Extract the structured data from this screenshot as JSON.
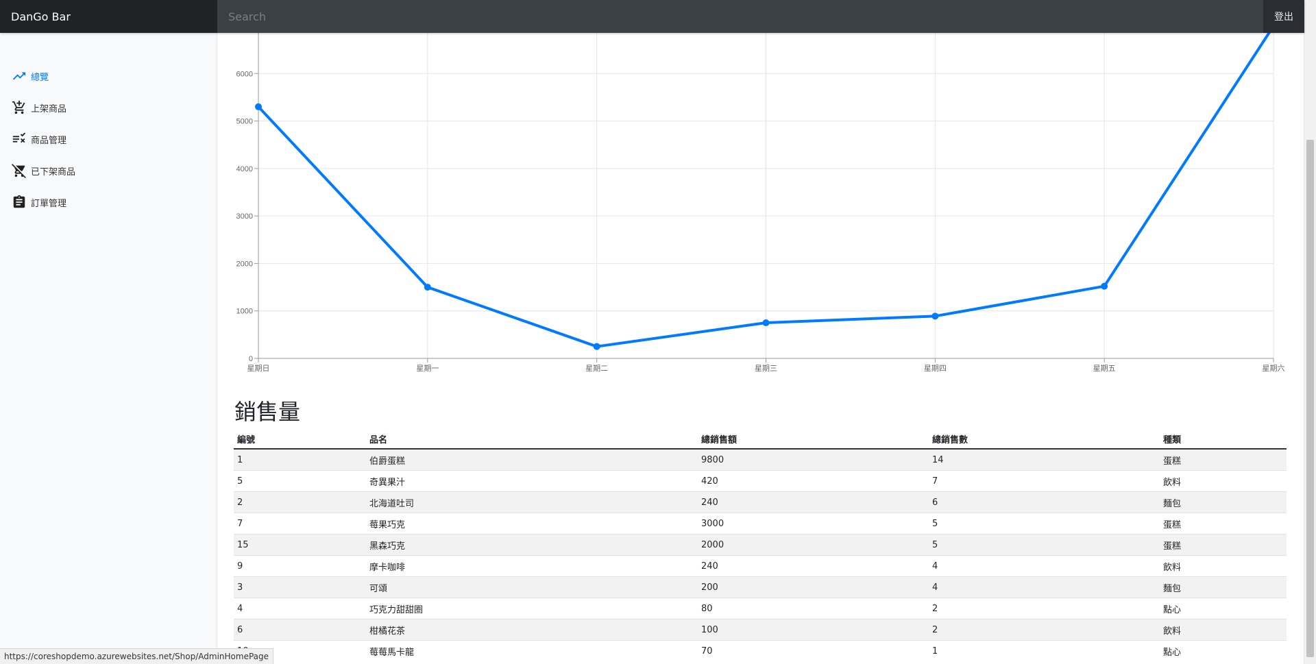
{
  "header": {
    "brand": "DanGo Bar",
    "search_placeholder": "Search",
    "logout_label": "登出"
  },
  "sidebar": {
    "items": [
      {
        "label": "總覽",
        "icon": "trending-up-icon",
        "active": true
      },
      {
        "label": "上架商品",
        "icon": "add-shopping-cart-icon",
        "active": false
      },
      {
        "label": "商品管理",
        "icon": "playlist-remove-icon",
        "active": false
      },
      {
        "label": "已下架商品",
        "icon": "remove-shopping-cart-icon",
        "active": false
      },
      {
        "label": "訂單管理",
        "icon": "assignment-icon",
        "active": false
      }
    ]
  },
  "chart_data": {
    "type": "line",
    "categories": [
      "星期日",
      "星期一",
      "星期二",
      "星期三",
      "星期四",
      "星期五",
      "星期六"
    ],
    "values": [
      5300,
      1500,
      250,
      750,
      890,
      1520,
      7000
    ],
    "yticks": [
      0,
      1000,
      2000,
      3000,
      4000,
      5000,
      6000
    ],
    "ylim": [
      0,
      7000
    ],
    "grid": true,
    "color": "#007bff"
  },
  "sales": {
    "title": "銷售量",
    "columns": [
      "編號",
      "品名",
      "總銷售額",
      "總銷售數",
      "種類"
    ],
    "rows": [
      [
        "1",
        "伯爵蛋糕",
        "9800",
        "14",
        "蛋糕"
      ],
      [
        "5",
        "奇異果汁",
        "420",
        "7",
        "飲料"
      ],
      [
        "2",
        "北海道吐司",
        "240",
        "6",
        "麵包"
      ],
      [
        "7",
        "莓果巧克",
        "3000",
        "5",
        "蛋糕"
      ],
      [
        "15",
        "黑森巧克",
        "2000",
        "5",
        "蛋糕"
      ],
      [
        "9",
        "摩卡咖啡",
        "240",
        "4",
        "飲料"
      ],
      [
        "3",
        "可頌",
        "200",
        "4",
        "麵包"
      ],
      [
        "4",
        "巧克力甜甜圈",
        "80",
        "2",
        "點心"
      ],
      [
        "6",
        "柑橘花茶",
        "100",
        "2",
        "飲料"
      ],
      [
        "10",
        "莓莓馬卡龍",
        "70",
        "1",
        "點心"
      ]
    ]
  },
  "status_bar": {
    "url": "https://coreshopdemo.azurewebsites.net/Shop/AdminHomePage"
  }
}
